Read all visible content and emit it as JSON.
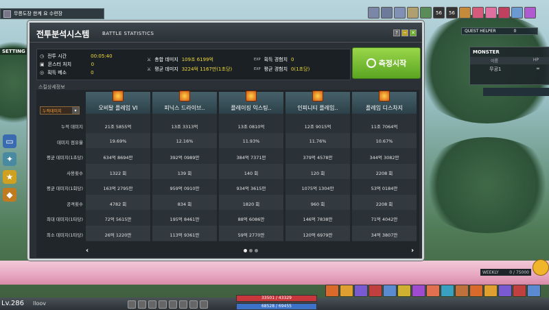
{
  "topbar": {
    "map_name": "무릉도장  한계 요 수련장"
  },
  "setting_label": "SETTING",
  "quest_helper": {
    "title": "QUEST HELPER",
    "count": "0"
  },
  "monster": {
    "title": "MONSTER",
    "col_name": "이름",
    "col_hp": "HP",
    "name": "무공1",
    "hp": "∞"
  },
  "level_badge": {
    "num1": "56",
    "num2": "56"
  },
  "window": {
    "title": "전투분석시스템",
    "subtitle": "BATTLE STATISTICS",
    "help": "?",
    "minimize": "−",
    "close": "✕"
  },
  "stats": {
    "battle_time_label": "전투 시간",
    "battle_time": "00:05:40",
    "monster_kills_label": "몬스터 처치",
    "monster_kills": "0",
    "meso_label": "획득 메소",
    "meso": "0",
    "total_damage_label": "총합 데미지",
    "total_damage": "109조 6199억",
    "avg_damage_label": "평균 데미지",
    "avg_damage": "3224억 1167만(1초당)",
    "exp_label": "획득 경험치",
    "exp": "0",
    "avg_exp_label": "평균 경험치",
    "avg_exp": "0(1초당)",
    "exp_tag": "EXP"
  },
  "start_button": "측정시작",
  "skill_section_label": "스킬상세정보",
  "dropdown": "누적데미지",
  "row_labels": [
    "누적 데미지",
    "데미지 점유율",
    "평균 데미지(1초당)",
    "사용횟수",
    "평균 데미지(1회당)",
    "공격횟수",
    "최대 데미지(1타당)",
    "최소 데미지(1타당)"
  ],
  "skills": [
    {
      "name": "오비탈 플레임 VI",
      "values": [
        "21조 5855억",
        "19.69%",
        "634억 8694만",
        "1322 회",
        "163억 2795만",
        "4782 회",
        "72억 5615만",
        "26억 1220만"
      ]
    },
    {
      "name": "피닉스 드라이브..",
      "values": [
        "13조 3313억",
        "12.16%",
        "392억 0989만",
        "139 회",
        "959억 0910만",
        "834 회",
        "195억 8461만",
        "113억 9361만"
      ]
    },
    {
      "name": "플레이징 익스팅..",
      "values": [
        "13조 0810억",
        "11.93%",
        "384억 7371만",
        "140 회",
        "934억 3615만",
        "1820 회",
        "88억 6086만",
        "59억 2770만"
      ]
    },
    {
      "name": "인피니티 플레임..",
      "values": [
        "12조 9015억",
        "11.76%",
        "379억 4578만",
        "120 회",
        "1075억 1304만",
        "960 회",
        "146억 7838만",
        "120억 6979만"
      ]
    },
    {
      "name": "플레임 디스차지",
      "values": [
        "11조 7064억",
        "10.67%",
        "344억 3082만",
        "2208 회",
        "53억 0184만",
        "2208 회",
        "71억 4042만",
        "34억 3807만"
      ]
    }
  ],
  "nav": {
    "prev": "‹",
    "next": "›"
  },
  "hud": {
    "level": "Lv.286",
    "name": "lloov",
    "hp": "33501 / 43329",
    "mp": "68528 / 69455"
  },
  "weekly": {
    "label": "WEEKLY",
    "value": "0 / 75000"
  },
  "colors": {
    "accent_yellow": "#f2dc3b",
    "start_green": "#7cc23a",
    "window_bg": "#2a3036"
  }
}
